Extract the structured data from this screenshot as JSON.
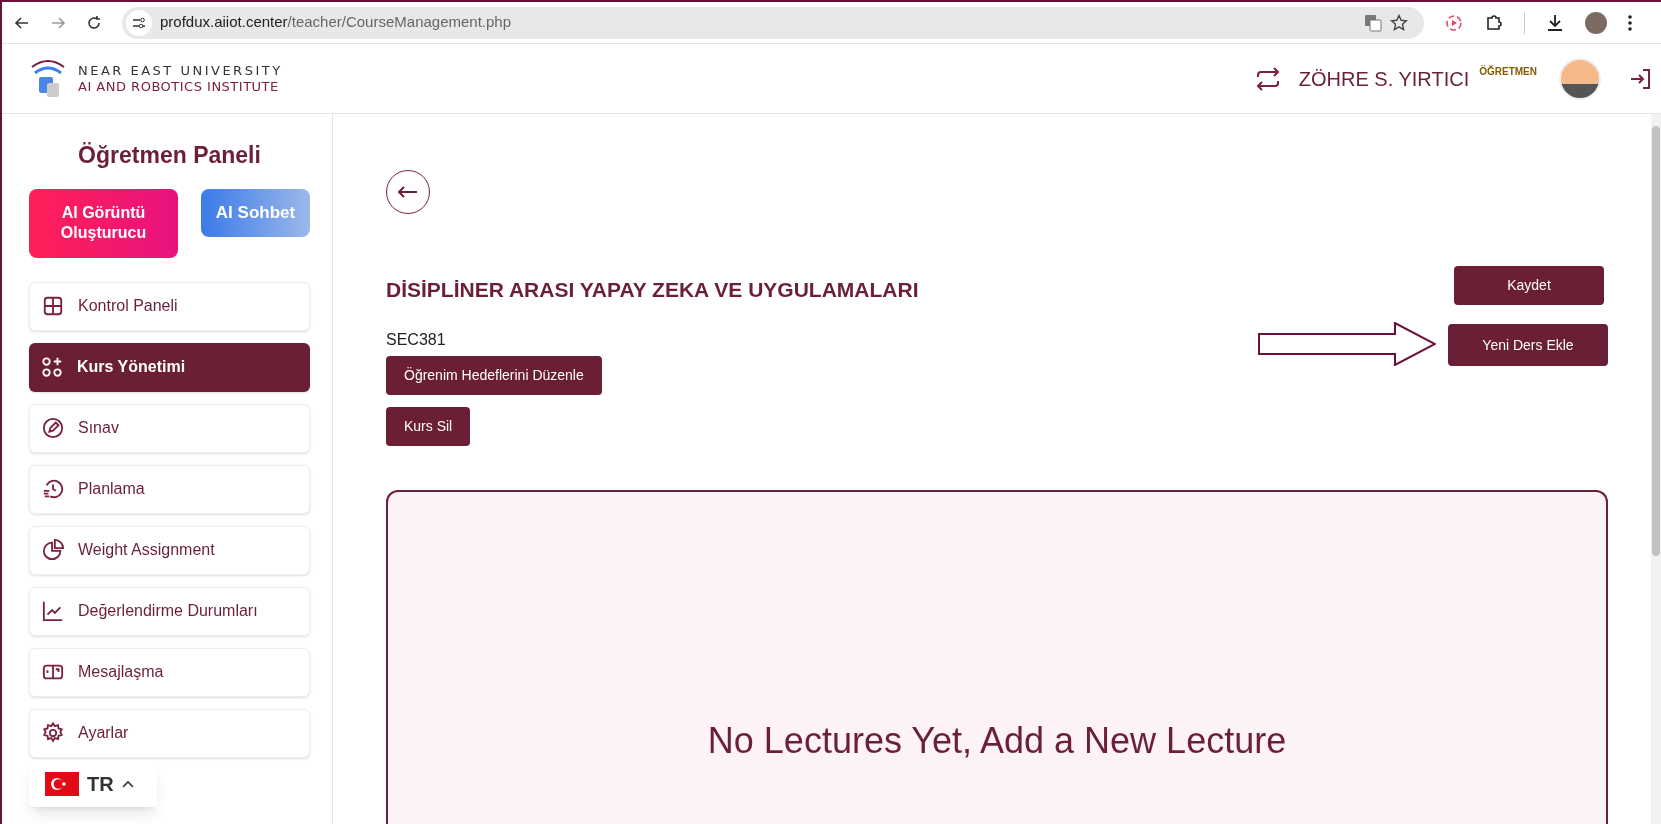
{
  "browser": {
    "url_host": "profdux.aiiot.center",
    "url_path": "/teacher/CourseManagement.php"
  },
  "header": {
    "logo_line_1": "NEAR EAST UNIVERSITY",
    "logo_line_2": "AI AND ROBOTICS INSTITUTE",
    "user_name": "ZÖHRE S. YIRTICI",
    "role": "ÖĞRETMEN"
  },
  "sidebar": {
    "title": "Öğretmen Paneli",
    "ai_buttons": [
      {
        "label": "AI Görüntü Oluşturucu",
        "kind": "image"
      },
      {
        "label": "AI Sohbet",
        "kind": "chat"
      }
    ],
    "items": [
      {
        "label": "Kontrol Paneli",
        "selected": false
      },
      {
        "label": "Kurs Yönetimi",
        "selected": true
      },
      {
        "label": "Sınav",
        "selected": false
      },
      {
        "label": "Planlama",
        "selected": false
      },
      {
        "label": "Weight Assignment",
        "selected": false
      },
      {
        "label": "Değerlendirme Durumları",
        "selected": false
      },
      {
        "label": "Mesajlaşma",
        "selected": false
      },
      {
        "label": "Ayarlar",
        "selected": false
      }
    ],
    "language": "TR"
  },
  "course": {
    "title": "DİSİPLİNER ARASI YAPAY ZEKA VE UYGULAMALARI",
    "code": "SEC381",
    "left_buttons": [
      "Öğrenim Hedeflerini Düzenle",
      "Kurs Sil"
    ],
    "right_buttons": [
      "Kaydet",
      "Yeni Ders Ekle"
    ],
    "empty_message": "No Lectures Yet, Add a New Lecture"
  }
}
